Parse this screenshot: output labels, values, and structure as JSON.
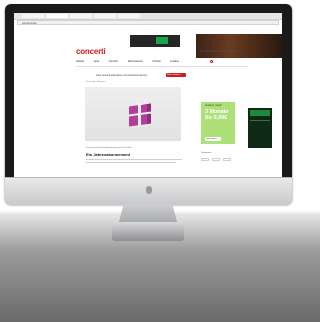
{
  "browser": {
    "url": "concerti.de"
  },
  "site": {
    "logo": "concerti",
    "top_links": "Abo   Newsletter   Mediadaten   Kontakt",
    "nav": [
      "Aktuell",
      "Oper",
      "Konzert",
      "Rezensionen",
      "Porträt",
      "Lexikon"
    ],
    "promo_text": "Jetzt concerti abonnieren und Geschenk sichern",
    "promo_button": "Mehr erfahren",
    "breadcrumb": "Startseite › Magazin",
    "article_meta": "Das concerti-Jahresabonnement als Geschenk",
    "article_title": "Ein Jahresabonnement",
    "sidebar_label": "Kategorien"
  },
  "ad": {
    "brand": "amazon music",
    "headline": "3 Monate für 0,99€",
    "button": "Jetzt starten"
  },
  "colors": {
    "brand": "#cc1d1d",
    "ad_green": "#aee07a"
  }
}
